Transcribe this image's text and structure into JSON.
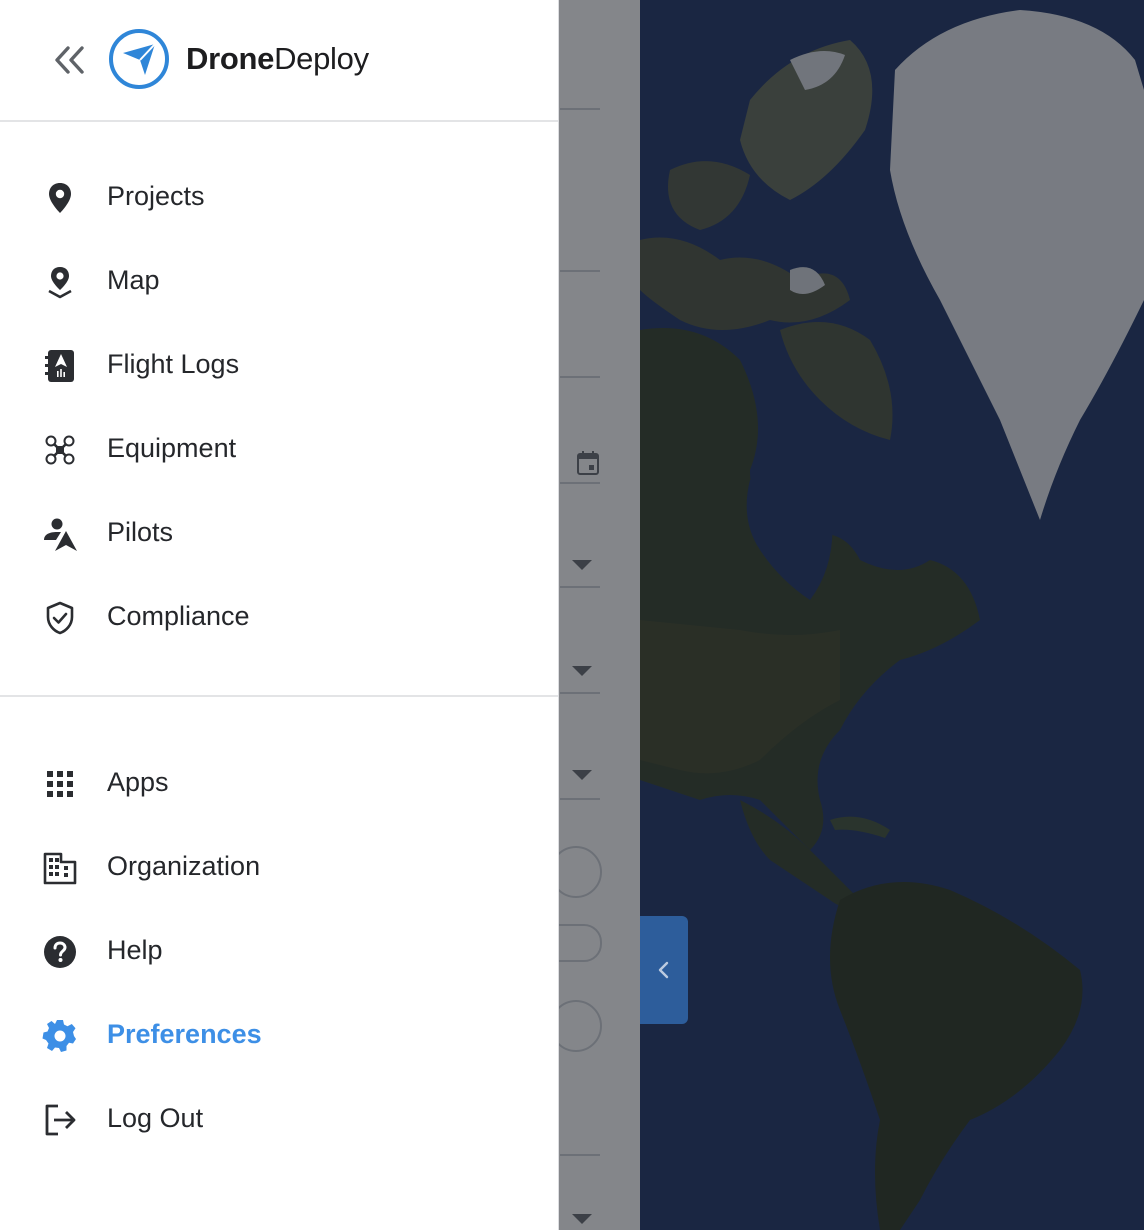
{
  "brand": {
    "name_bold": "Drone",
    "name_regular": "Deploy",
    "color": "#2f86d8"
  },
  "header": {
    "back_icon": "double-chevron-left-icon"
  },
  "nav_primary": [
    {
      "label": "Projects",
      "icon": "map-pin-icon"
    },
    {
      "label": "Map",
      "icon": "map-location-icon"
    },
    {
      "label": "Flight Logs",
      "icon": "flight-log-book-icon"
    },
    {
      "label": "Equipment",
      "icon": "drone-icon"
    },
    {
      "label": "Pilots",
      "icon": "pilot-icon"
    },
    {
      "label": "Compliance",
      "icon": "shield-check-icon"
    }
  ],
  "nav_secondary": [
    {
      "label": "Apps",
      "icon": "apps-grid-icon"
    },
    {
      "label": "Organization",
      "icon": "building-icon"
    },
    {
      "label": "Help",
      "icon": "help-circle-icon"
    },
    {
      "label": "Preferences",
      "icon": "gear-icon",
      "active": true
    },
    {
      "label": "Log Out",
      "icon": "logout-icon"
    }
  ],
  "colors": {
    "active": "#3d8fe6",
    "text": "#25272b",
    "panel_tab": "#2d5d9b"
  }
}
